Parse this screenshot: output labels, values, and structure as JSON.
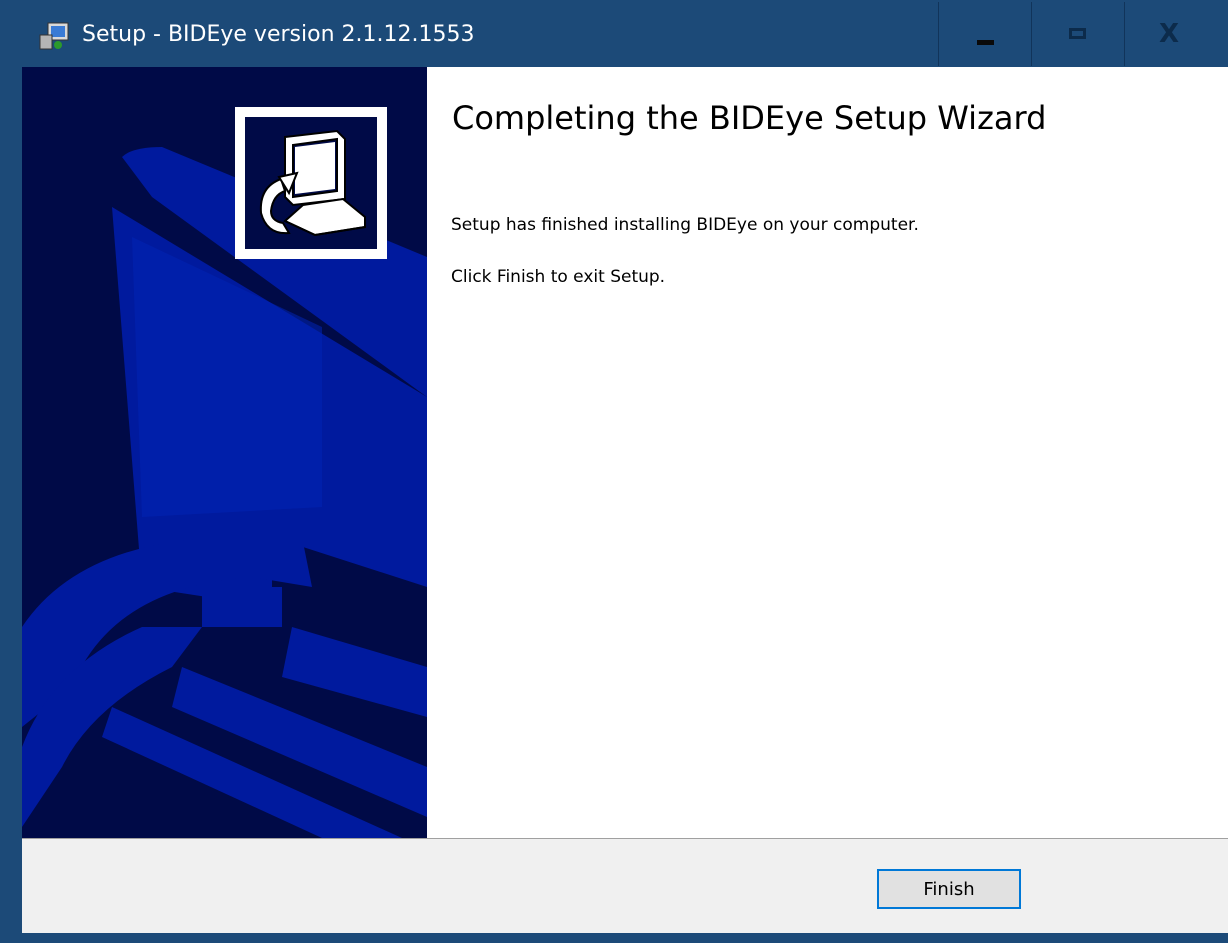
{
  "window": {
    "title": "Setup - BIDEye version 2.1.12.1553",
    "controls": {
      "minimize": "minimize-icon",
      "maximize": "maximize-icon",
      "close_glyph": "X"
    }
  },
  "wizard": {
    "heading": "Completing the BIDEye Setup Wizard",
    "message_1": "Setup has finished installing BIDEye on your computer.",
    "message_2": "Click Finish to exit Setup."
  },
  "footer": {
    "finish_label": "Finish"
  },
  "colors": {
    "titlebar": "#1c4a78",
    "side_panel": "#000a47",
    "side_pattern": "#001a9e",
    "button_focus": "#0078d7"
  }
}
